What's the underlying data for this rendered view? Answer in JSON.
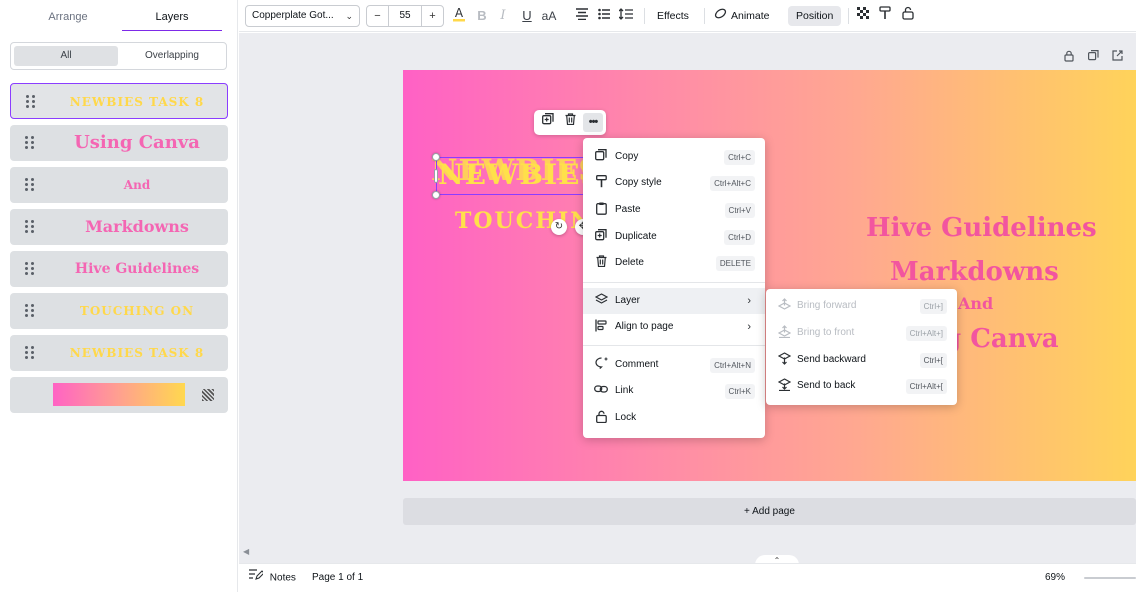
{
  "left_panel": {
    "tabs": {
      "arrange": "Arrange",
      "layers": "Layers"
    },
    "filter": {
      "all": "All",
      "overlapping": "Overlapping"
    },
    "layers": [
      {
        "text": "NEWBIES TASK 8",
        "color": "#ffd84a",
        "selected": true
      },
      {
        "text": "Using Canva",
        "color": "#f466b3"
      },
      {
        "text": "And",
        "color": "#f466b3"
      },
      {
        "text": "Markdowns",
        "color": "#f466b3"
      },
      {
        "text": "Hive Guidelines",
        "color": "#f466b3"
      },
      {
        "text": "TOUCHING ON",
        "color": "#ffd84a"
      },
      {
        "text": "NEWBIES TASK 8",
        "color": "#ffd84a"
      }
    ],
    "background_layer": {
      "gradient": [
        "#ff63c4",
        "#ffa08f",
        "#ffd84f"
      ]
    }
  },
  "toolbar": {
    "font": "Copperplate Got...",
    "size": {
      "minus": "−",
      "value": "55",
      "plus": "+"
    },
    "effects": "Effects",
    "animate": "Animate",
    "position": "Position"
  },
  "canvas": {
    "texts": {
      "newbies": "NEWBIES",
      "touching": "TOUCHIN",
      "hive": "Hive Guidelines",
      "markdowns": "Markdowns",
      "and": "And",
      "canva": "g Canva"
    },
    "colors": {
      "pink": "#f2559f",
      "yellow": "#ffe04a",
      "selection": "#8b3dff"
    }
  },
  "context_menu": {
    "items": [
      {
        "icon": "copy-icon",
        "label": "Copy",
        "shortcut": "Ctrl+C"
      },
      {
        "icon": "paint-roller-icon",
        "label": "Copy style",
        "shortcut": "Ctrl+Alt+C"
      },
      {
        "icon": "clipboard-icon",
        "label": "Paste",
        "shortcut": "Ctrl+V"
      },
      {
        "icon": "duplicate-icon",
        "label": "Duplicate",
        "shortcut": "Ctrl+D"
      },
      {
        "icon": "trash-icon",
        "label": "Delete",
        "shortcut": "DELETE"
      },
      {
        "icon": "layers-icon",
        "label": "Layer"
      },
      {
        "icon": "align-icon",
        "label": "Align to page"
      },
      {
        "icon": "comment-icon",
        "label": "Comment",
        "shortcut": "Ctrl+Alt+N"
      },
      {
        "icon": "link-icon",
        "label": "Link",
        "shortcut": "Ctrl+K"
      },
      {
        "icon": "lock-icon",
        "label": "Lock"
      }
    ]
  },
  "sub_menu": {
    "items": [
      {
        "icon": "bring-forward-icon",
        "label": "Bring forward",
        "shortcut": "Ctrl+]",
        "disabled": true
      },
      {
        "icon": "bring-to-front-icon",
        "label": "Bring to front",
        "shortcut": "Ctrl+Alt+]",
        "disabled": true
      },
      {
        "icon": "send-backward-icon",
        "label": "Send backward",
        "shortcut": "Ctrl+["
      },
      {
        "icon": "send-to-back-icon",
        "label": "Send to back",
        "shortcut": "Ctrl+Alt+["
      }
    ]
  },
  "workspace": {
    "add_page": "+ Add page"
  },
  "status_bar": {
    "notes": "Notes",
    "page": "Page 1 of 1",
    "zoom": "69%"
  }
}
